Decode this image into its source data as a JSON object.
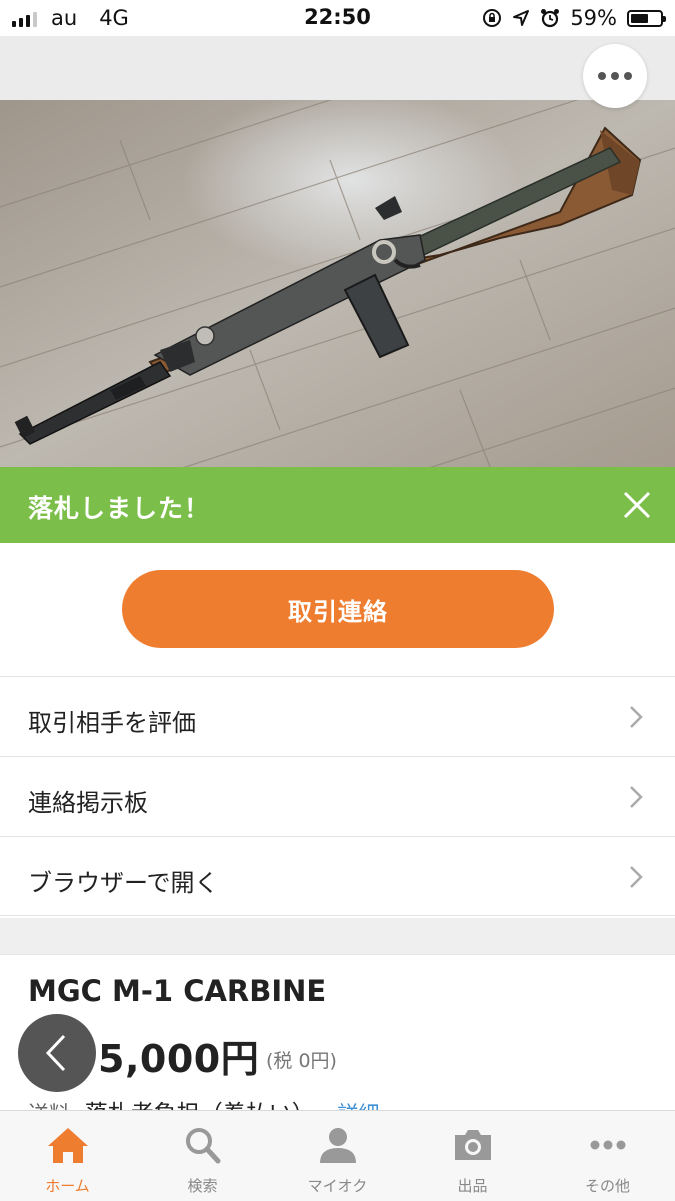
{
  "status_bar": {
    "carrier": "au",
    "network": "4G",
    "time": "22:50",
    "battery": "59%",
    "battery_level": 0.59
  },
  "header": {
    "more_icon": "more-horizontal-icon"
  },
  "banner": {
    "text": "落札しました！",
    "close_icon": "close-icon",
    "color": "#7bbf4a"
  },
  "primary_action": {
    "label": "取引連絡",
    "color": "#ef7d30"
  },
  "menu": {
    "items": [
      {
        "label": "取引相手を評価"
      },
      {
        "label": "連絡掲示板"
      },
      {
        "label": "ブラウザーで開く"
      }
    ]
  },
  "item": {
    "title": "MGC M-1 CARBINE",
    "price": "5,000円",
    "tax": "(税 0円)",
    "shipping_label": "送料",
    "shipping_value": "落札者負担（着払い）",
    "shipping_link": "詳細"
  },
  "tabbar": {
    "tabs": [
      {
        "label": "ホーム",
        "icon": "home-icon",
        "active": true
      },
      {
        "label": "検索",
        "icon": "search-icon",
        "active": false
      },
      {
        "label": "マイオク",
        "icon": "user-icon",
        "active": false
      },
      {
        "label": "出品",
        "icon": "camera-icon",
        "active": false
      },
      {
        "label": "その他",
        "icon": "more-horizontal-icon",
        "active": false
      }
    ],
    "active_color": "#ef7d30"
  }
}
